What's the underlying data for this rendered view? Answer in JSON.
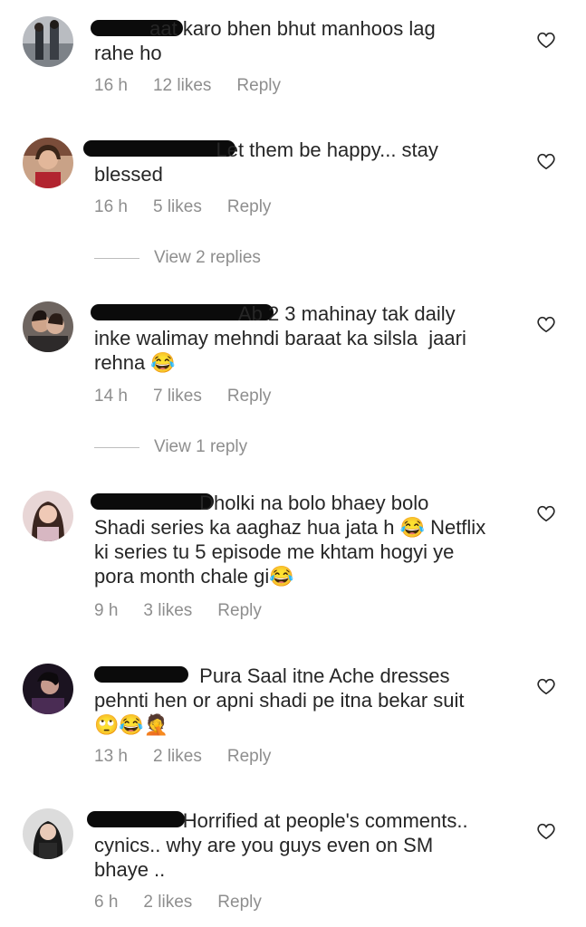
{
  "comments": [
    {
      "text": "          aat karo bhen bhut manhoos lag\nrahe ho",
      "time": "16 h",
      "likes": "12 likes",
      "reply": "Reply"
    },
    {
      "text": "                      Let them be happy... stay\nblessed",
      "time": "16 h",
      "likes": "5 likes",
      "reply": "Reply",
      "view_replies": "View 2 replies"
    },
    {
      "text": "                          Ab 2 3 mahinay tak daily\ninke walimay mehndi baraat ka silsla  jaari\nrehna 😂",
      "time": "14 h",
      "likes": "7 likes",
      "reply": "Reply",
      "view_replies": "View 1 reply"
    },
    {
      "text": "                   Dholki na bolo bhaey bolo\nShadi series ka aaghaz hua jata h 😂 Netflix\nki series tu 5 episode me khtam hogyi ye\npora month chale gi😂",
      "time": "9 h",
      "likes": "3 likes",
      "reply": "Reply"
    },
    {
      "text": "                   Pura Saal itne Ache dresses\npehnti hen or apni shadi pe itna bekar suit\n🙄😂🤦",
      "time": "13 h",
      "likes": "2 likes",
      "reply": "Reply"
    },
    {
      "text": "                Horrified at people's comments..\ncynics.. why are you guys even on SM\nbhaye ..",
      "time": "6 h",
      "likes": "2 likes",
      "reply": "Reply"
    }
  ],
  "icons": {
    "like": "heart-outline-icon"
  },
  "colors": {
    "text": "#262626",
    "meta": "#8e8e8e",
    "redaction": "#0b0b0b"
  }
}
